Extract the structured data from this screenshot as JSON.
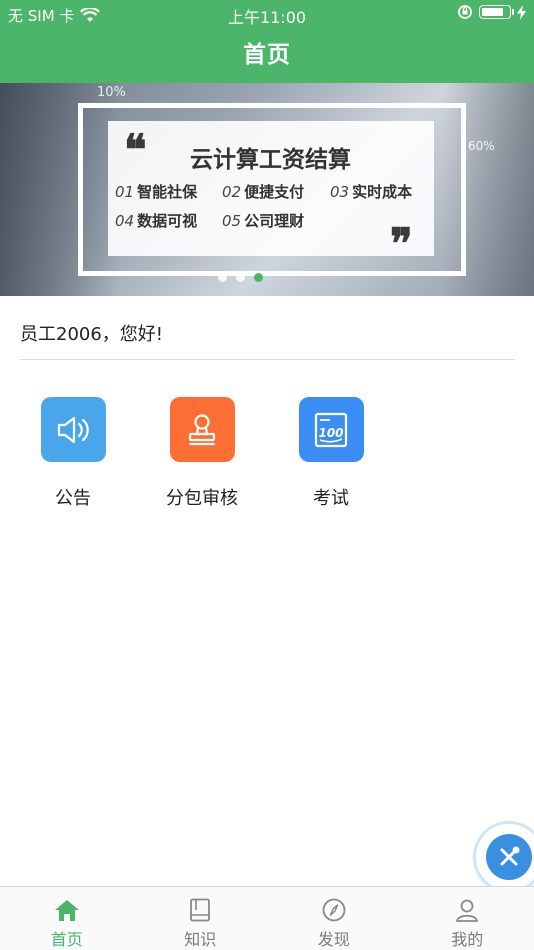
{
  "status_bar": {
    "carrier": "无 SIM 卡",
    "time": "上午11:00"
  },
  "nav": {
    "title": "首页"
  },
  "banner": {
    "title": "云计算工资结算",
    "features": [
      {
        "num": "01",
        "label": "智能社保"
      },
      {
        "num": "02",
        "label": "便捷支付"
      },
      {
        "num": "03",
        "label": "实时成本"
      },
      {
        "num": "04",
        "label": "数据可视"
      },
      {
        "num": "05",
        "label": "公司理财"
      }
    ],
    "bg_text_1": "10%",
    "bg_text_2": "60%",
    "slides_count": 3,
    "active_slide": 3
  },
  "greeting": "员工2006，您好!",
  "menu": [
    {
      "label": "公告",
      "icon": "speaker-icon",
      "color": "#4aa6ea"
    },
    {
      "label": "分包审核",
      "icon": "stamp-icon",
      "color": "#fb6f35"
    },
    {
      "label": "考试",
      "icon": "exam-score-icon",
      "color": "#3a8ef3"
    }
  ],
  "tabbar": {
    "active_color": "#4bb56a",
    "items": [
      {
        "label": "首页",
        "icon": "home-icon",
        "active": true
      },
      {
        "label": "知识",
        "icon": "book-icon",
        "active": false
      },
      {
        "label": "发现",
        "icon": "compass-icon",
        "active": false
      },
      {
        "label": "我的",
        "icon": "user-icon",
        "active": false
      }
    ]
  },
  "floating_button": {
    "icon": "tools-icon"
  }
}
